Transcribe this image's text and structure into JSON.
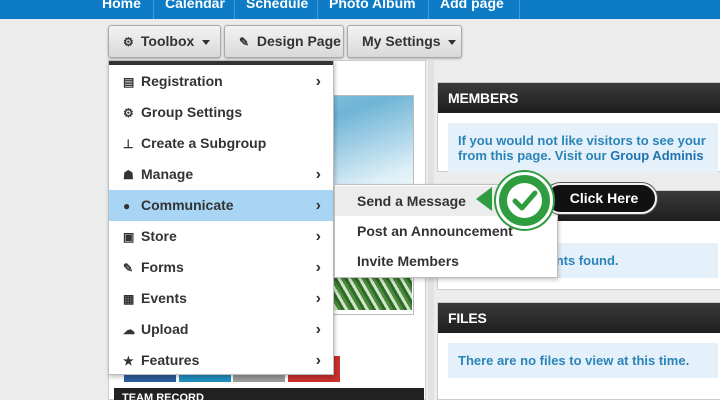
{
  "topnav": {
    "items": [
      {
        "label": "Home"
      },
      {
        "label": "Calendar"
      },
      {
        "label": "Schedule"
      },
      {
        "label": "Photo Album"
      },
      {
        "label": "Add page"
      }
    ]
  },
  "toolbar": {
    "toolbox_label": "Toolbox",
    "design_label": "Design Page",
    "settings_label": "My Settings"
  },
  "menu": {
    "items": [
      {
        "label": "Registration",
        "icon": "list-icon",
        "has_submenu": true
      },
      {
        "label": "Group Settings",
        "icon": "gear-icon",
        "has_submenu": false
      },
      {
        "label": "Create a Subgroup",
        "icon": "sitemap-icon",
        "has_submenu": false
      },
      {
        "label": "Manage",
        "icon": "users-icon",
        "has_submenu": true
      },
      {
        "label": "Communicate",
        "icon": "chat-icon",
        "has_submenu": true,
        "active": true
      },
      {
        "label": "Store",
        "icon": "money-icon",
        "has_submenu": true
      },
      {
        "label": "Forms",
        "icon": "edit-icon",
        "has_submenu": true
      },
      {
        "label": "Events",
        "icon": "calendar-icon",
        "has_submenu": true
      },
      {
        "label": "Upload",
        "icon": "cloud-upload-icon",
        "has_submenu": true
      },
      {
        "label": "Features",
        "icon": "star-icon",
        "has_submenu": true
      }
    ]
  },
  "submenu": {
    "items": [
      {
        "label": "Send a Message",
        "hover": true
      },
      {
        "label": "Post an Announcement"
      },
      {
        "label": "Invite Members"
      }
    ]
  },
  "callout": {
    "label": "Click Here"
  },
  "widgets": {
    "members": {
      "title": "MEMBERS",
      "line1": "If you would not like visitors to see your",
      "line2_pre": "from this page. Visit our ",
      "line2_link": "Group Adminis"
    },
    "events": {
      "message": "events found."
    },
    "files": {
      "title": "FILES",
      "message": "There are no files to view at this time."
    }
  },
  "left": {
    "team_title": "TEAM RECORD"
  },
  "colors": {
    "nav_blue": "#0d7bc6",
    "menu_active": "#a9d5f5",
    "widget_text": "#2b84b8",
    "callout_green": "#2f9d3f"
  }
}
